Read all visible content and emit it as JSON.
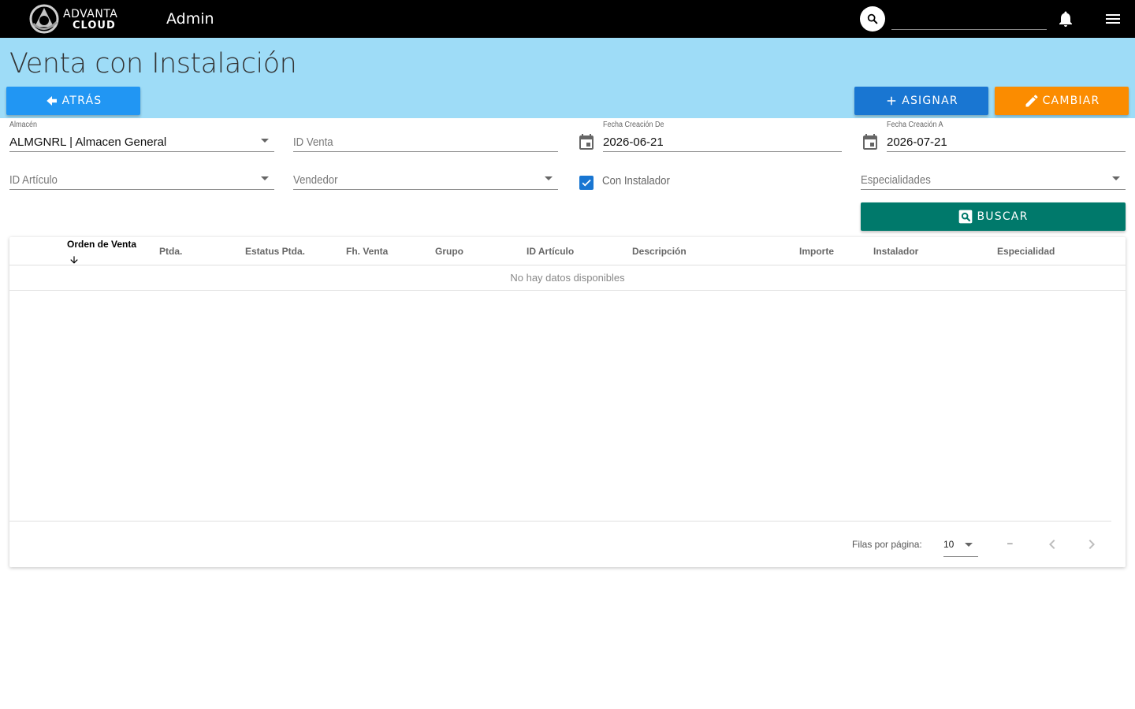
{
  "topbar": {
    "logo_line1": "ADVANTA",
    "logo_line2": "CLOUD",
    "section": "Admin",
    "search_value": ""
  },
  "header": {
    "title": "Venta con Instalación",
    "back_label": "ATRÁS",
    "assign_label": "ASIGNAR",
    "change_label": "CAMBIAR"
  },
  "filters": {
    "almacen": {
      "label": "Almacén",
      "value": "ALMGNRL | Almacen General"
    },
    "id_venta": {
      "placeholder": "ID Venta"
    },
    "fecha_de": {
      "label": "Fecha Creación De",
      "value": "2026-06-21"
    },
    "fecha_a": {
      "label": "Fecha Creación A",
      "value": "2026-07-21"
    },
    "id_articulo": {
      "placeholder": "ID Artículo"
    },
    "vendedor": {
      "placeholder": "Vendedor"
    },
    "con_instalador": {
      "label": "Con Instalador",
      "checked": true
    },
    "especialidades": {
      "placeholder": "Especialidades"
    },
    "search_label": "BUSCAR"
  },
  "table": {
    "columns": [
      "Orden de Venta",
      "Ptda.",
      "Estatus Ptda.",
      "Fh. Venta",
      "Grupo",
      "ID Artículo",
      "Descripción",
      "Importe",
      "Instalador",
      "Especialidad"
    ],
    "empty_text": "No hay datos disponibles",
    "rows_per_page_label": "Filas por página:",
    "rows_per_page": "10",
    "range": "–"
  },
  "colors": {
    "topbar": "#000000",
    "header_bg": "#9edcf7",
    "back_button": "#2196f3",
    "assign_button": "#1976d2",
    "change_button": "#fb8c00",
    "search_button": "#00796b",
    "checkbox": "#1976d2"
  },
  "icons": {
    "search": "search-icon",
    "bell": "bell-icon",
    "menu": "menu-icon",
    "back": "arrow-left-icon",
    "assign": "plus-icon",
    "change": "pencil-icon",
    "calendar": "calendar-icon",
    "buscar": "search-box-icon",
    "sort": "arrow-down-icon"
  }
}
